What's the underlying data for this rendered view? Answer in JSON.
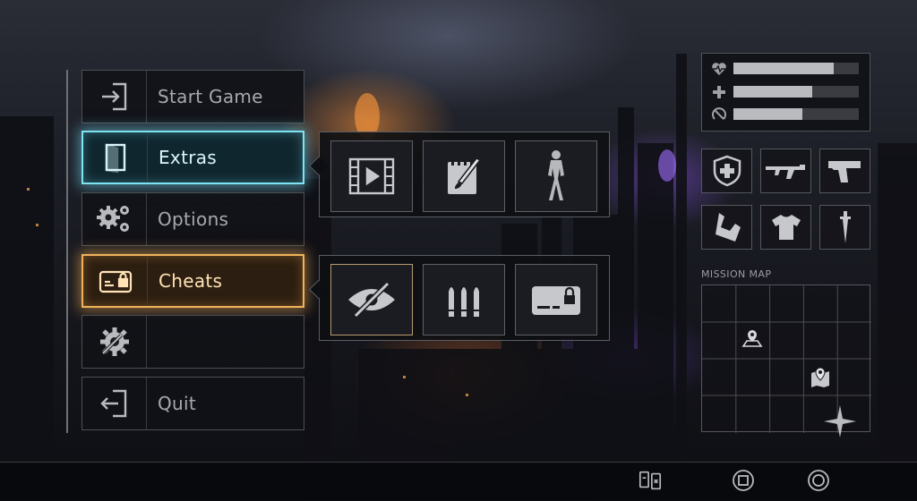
{
  "menu": {
    "items": [
      {
        "id": "start",
        "label": "Start Game",
        "icon": "enter-door-icon"
      },
      {
        "id": "extras",
        "label": "Extras",
        "icon": "open-door-icon",
        "state": "selected",
        "highlight": "#7fe3f2"
      },
      {
        "id": "options",
        "label": "Options",
        "icon": "gears-icon"
      },
      {
        "id": "cheats",
        "label": "Cheats",
        "icon": "locked-card-icon",
        "state": "selected",
        "highlight": "#f0b35a"
      },
      {
        "id": "unnamed",
        "label": "",
        "icon": "wrench-gear-icon"
      },
      {
        "id": "quit",
        "label": "Quit",
        "icon": "exit-door-icon"
      }
    ]
  },
  "extras_submenu": {
    "tiles": [
      {
        "icon": "film-play-icon"
      },
      {
        "icon": "notepad-brush-icon"
      },
      {
        "icon": "character-figure-icon"
      }
    ]
  },
  "cheats_submenu": {
    "tiles": [
      {
        "icon": "eye-slash-icon",
        "selected": true
      },
      {
        "icon": "ammo-bullets-icon"
      },
      {
        "icon": "locked-card-icon"
      }
    ]
  },
  "stats": [
    {
      "icon": "heartbeat-icon",
      "level": 0.8
    },
    {
      "icon": "plus-cross-icon",
      "level": 0.63
    },
    {
      "icon": "stamina-icon",
      "level": 0.55
    }
  ],
  "inventory": [
    {
      "icon": "shield-cross-icon"
    },
    {
      "icon": "rifle-icon"
    },
    {
      "icon": "pistol-icon"
    },
    {
      "icon": "vest-icon"
    },
    {
      "icon": "shirt-icon"
    },
    {
      "icon": "dagger-icon"
    }
  ],
  "mission_map": {
    "title": "MISSION MAP",
    "grid": {
      "cols": 5,
      "rows": 4
    },
    "markers": [
      {
        "icon": "map-pin-icon",
        "col": 1,
        "row": 1
      },
      {
        "icon": "map-pin-icon",
        "col": 3,
        "row": 2
      },
      {
        "icon": "compass-star-icon",
        "col": 4,
        "row": 3
      }
    ]
  },
  "bottom_buttons": [
    {
      "icon": "card-swap-icon"
    },
    {
      "icon": "square-button-icon"
    },
    {
      "icon": "circle-button-icon"
    }
  ],
  "colors": {
    "extras_glow": "#7fe3f2",
    "cheats_glow": "#f0b35a"
  }
}
